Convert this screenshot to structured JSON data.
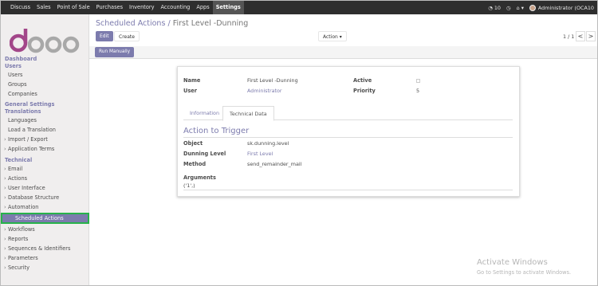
{
  "topbar": {
    "menu": [
      "Discuss",
      "Sales",
      "Point of Sale",
      "Purchases",
      "Inventory",
      "Accounting",
      "Apps",
      "Settings"
    ],
    "active_menu": "Settings",
    "chat_count": "10",
    "user": "Administrator (OCA10"
  },
  "sidebar": {
    "dashboard": "Dashboard",
    "users_header": "Users",
    "users": [
      "Users",
      "Groups",
      "Companies"
    ],
    "general_settings": "General Settings",
    "translations_header": "Translations",
    "translations": [
      "Languages",
      "Load a Translation"
    ],
    "translations_caret": [
      "Import / Export",
      "Application Terms"
    ],
    "technical_header": "Technical",
    "technical": [
      "Email",
      "Actions",
      "User Interface",
      "Database Structure",
      "Automation"
    ],
    "active_item": "Scheduled Actions",
    "technical_after": [
      "Workflows",
      "Reports",
      "Sequences & Identifiers",
      "Parameters",
      "Security"
    ]
  },
  "control_panel": {
    "breadcrumb_parent": "Scheduled Actions",
    "breadcrumb_sep": "/",
    "breadcrumb_current": "First Level -Dunning",
    "edit_label": "Edit",
    "create_label": "Create",
    "action_label": "Action",
    "pager": "1 / 1",
    "prev": "<",
    "next": ">"
  },
  "statusbar": {
    "run_label": "Run Manually"
  },
  "form": {
    "name_label": "Name",
    "name_value": "First Level -Dunning",
    "user_label": "User",
    "user_value": "Administrator",
    "active_label": "Active",
    "priority_label": "Priority",
    "priority_value": "5",
    "tabs": [
      "Information",
      "Technical Data"
    ],
    "active_tab": "Technical Data",
    "section_title": "Action to Trigger",
    "object_label": "Object",
    "object_value": "sk.dunning.level",
    "dunning_label": "Dunning Level",
    "dunning_value": "First Level",
    "method_label": "Method",
    "method_value": "send_remainder_mail",
    "arguments_label": "Arguments",
    "arguments_value": "('1',)"
  },
  "watermark": {
    "title": "Activate Windows",
    "subtitle": "Go to Settings to activate Windows."
  },
  "colors": {
    "accent": "#7c7bad",
    "topbar": "#2e2e2e",
    "highlight_border": "#27b24a"
  }
}
